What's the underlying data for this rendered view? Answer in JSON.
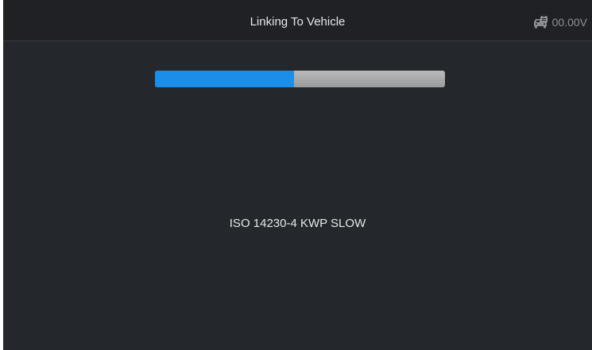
{
  "header": {
    "title": "Linking To Vehicle",
    "battery_icon": "car-battery-icon",
    "voltage": "00.00V"
  },
  "progress": {
    "fraction": 0.48,
    "fill_color": "#1a8ee8",
    "track_color": "#a8a9aa"
  },
  "status": {
    "protocol": "ISO 14230-4 KWP SLOW"
  },
  "colors": {
    "background": "#24272b",
    "title_bar": "#1f2125",
    "text": "#e6e7e9",
    "muted_text": "#8c8f94"
  }
}
